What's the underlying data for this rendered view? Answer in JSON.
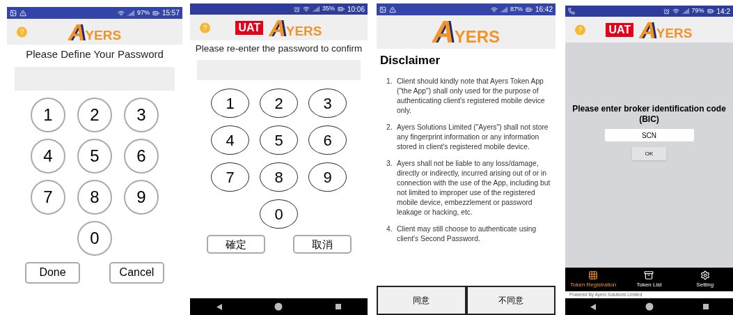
{
  "screens": [
    {
      "kind": "circle_keypad",
      "status_bar": {
        "kind": "samsung",
        "battery": "97%",
        "time": "15:57"
      },
      "header": {
        "help": "?",
        "logo_initial": "A",
        "logo_rest": "YERS"
      },
      "prompt": "Please Define Your Password",
      "keys": [
        "1",
        "2",
        "3",
        "4",
        "5",
        "6",
        "7",
        "8",
        "9",
        "0"
      ],
      "buttons": [
        "Done",
        "Cancel"
      ]
    },
    {
      "kind": "oval_keypad",
      "status_bar": {
        "kind": "pixel",
        "battery": "35%",
        "time": "10:06"
      },
      "header": {
        "help": "?",
        "badge": "UAT",
        "logo_initial": "A",
        "logo_rest": "YERS"
      },
      "prompt": "Please re-enter the password to confirm",
      "keys": [
        "1",
        "2",
        "3",
        "4",
        "5",
        "6",
        "7",
        "8",
        "9",
        "0"
      ],
      "buttons": [
        "確定",
        "取消"
      ],
      "nav_bar": true
    },
    {
      "kind": "disclaimer",
      "status_bar": {
        "kind": "samsung",
        "battery": "87%",
        "time": "16:42"
      },
      "header": {
        "logo_initial": "A",
        "logo_rest": "YERS"
      },
      "title": "Disclaimer",
      "items": [
        {
          "number": "1.",
          "text": "Client should kindly note that Ayers Token App (\"the App\") shall only used for the purpose of authenticating client's registered mobile device only."
        },
        {
          "number": "2.",
          "text": "Ayers Solutions Limited (\"Ayers\") shall not store any fingerprint information or any information stored in client's registered mobile device."
        },
        {
          "number": "3.",
          "text": "Ayers shall not be liable to any loss/damage, directly or indirectly, incurred arising out of or in connection with the use of the App, including but not limited to improper use of the registered mobile device, embezzlement or password leakage or hacking, etc."
        },
        {
          "number": "4.",
          "text": "Client may still choose to authenticate using client's Second Password."
        }
      ],
      "buttons": [
        "同意",
        "不同意"
      ],
      "nav_bar": false
    },
    {
      "kind": "bic",
      "status_bar": {
        "kind": "pixel",
        "battery": "79%",
        "time": "14:2"
      },
      "header": {
        "help": "?",
        "badge": "UAT",
        "logo_initial": "A",
        "logo_rest": "YERS"
      },
      "prompt": "Please enter broker identification code (BIC)",
      "value": "SCN",
      "button": "OK",
      "tabs": [
        {
          "label": "Token Registration",
          "selected": true
        },
        {
          "label": "Token List",
          "selected": false
        },
        {
          "label": "Setting",
          "selected": false
        }
      ],
      "footer": "Powered By Ayers Solutions Limited",
      "nav_bar": true
    }
  ]
}
